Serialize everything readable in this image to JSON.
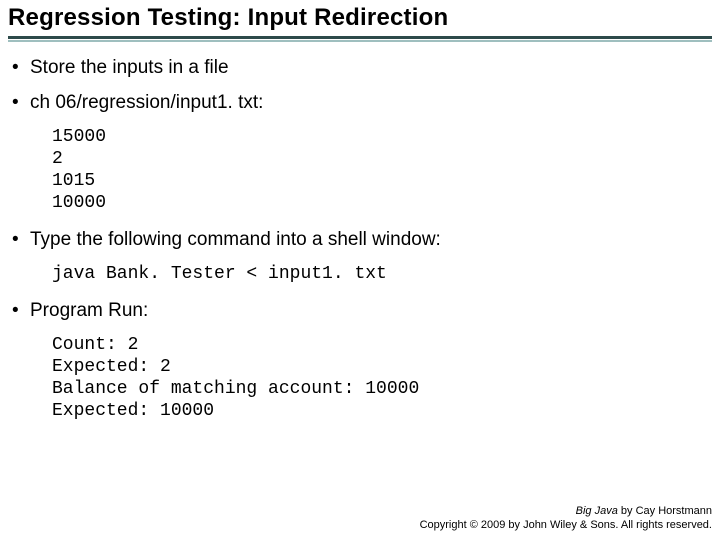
{
  "title": "Regression Testing: Input Redirection",
  "bullets": {
    "b1": "Store the inputs in a file",
    "b2": "ch 06/regression/input1. txt:",
    "b3": "Type the following command into a shell window:",
    "b4": "Program Run:"
  },
  "code": {
    "c1": "15000\n2\n1015\n10000",
    "c2": "java Bank. Tester < input1. txt",
    "c3": "Count: 2\nExpected: 2\nBalance of matching account: 10000\nExpected: 10000"
  },
  "footer": {
    "book": "Big Java",
    "by": " by Cay Horstmann",
    "copy": "Copyright © 2009 by John Wiley & Sons. All rights reserved."
  }
}
